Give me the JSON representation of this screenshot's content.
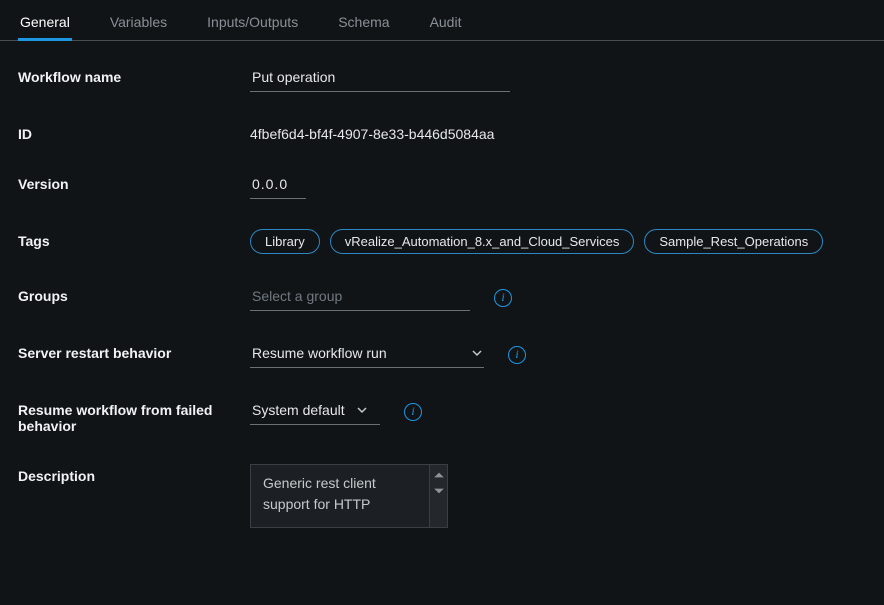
{
  "tabs": {
    "general": "General",
    "variables": "Variables",
    "io": "Inputs/Outputs",
    "schema": "Schema",
    "audit": "Audit"
  },
  "labels": {
    "workflow_name": "Workflow name",
    "id": "ID",
    "version": "Version",
    "tags": "Tags",
    "groups": "Groups",
    "server_restart": "Server restart behavior",
    "resume_failed": "Resume workflow from failed behavior",
    "description": "Description"
  },
  "values": {
    "workflow_name": "Put operation",
    "id": "4fbef6d4-bf4f-4907-8e33-b446d5084aa",
    "version": "0.0.0",
    "groups_placeholder": "Select a group",
    "server_restart": "Resume workflow run",
    "resume_failed": "System default",
    "description": "Generic rest client support for HTTP"
  },
  "tags": [
    "Library",
    "vRealize_Automation_8.x_and_Cloud_Services",
    "Sample_Rest_Operations"
  ],
  "info_glyph": "i"
}
